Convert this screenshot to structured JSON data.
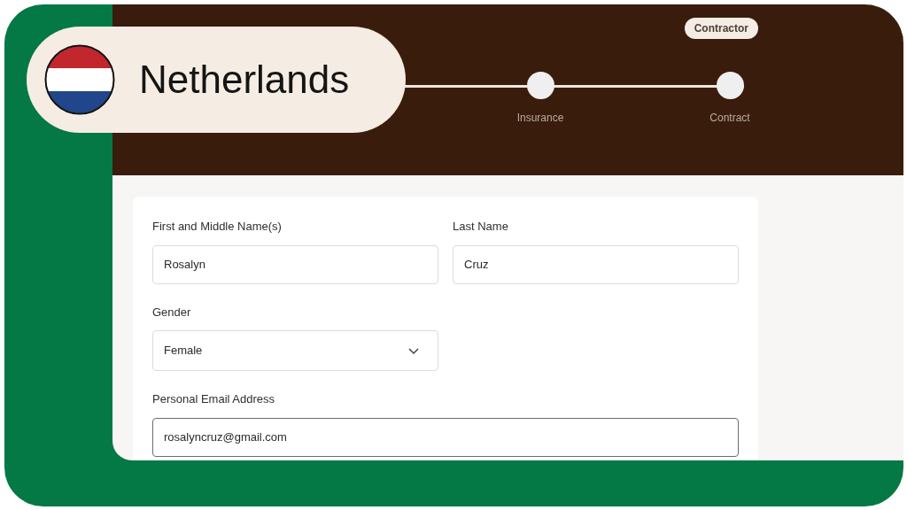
{
  "header": {
    "badge": "Contractor",
    "steps": [
      {
        "label": "Insurance"
      },
      {
        "label": "Contract"
      }
    ]
  },
  "form": {
    "fields": [
      {
        "label": "First and Middle Name(s)",
        "kind": "text",
        "value": "Rosalyn",
        "wide": false,
        "focused": false
      },
      {
        "label": "Last Name",
        "kind": "text",
        "value": "Cruz",
        "wide": false,
        "focused": false
      },
      {
        "label": "Gender",
        "kind": "select",
        "value": "Female",
        "wide": false,
        "focused": false
      },
      {
        "label": "Personal Email Address",
        "kind": "text",
        "value": "rosalyncruz@gmail.com",
        "wide": true,
        "focused": true
      }
    ]
  },
  "country_tag": {
    "name": "Netherlands"
  }
}
